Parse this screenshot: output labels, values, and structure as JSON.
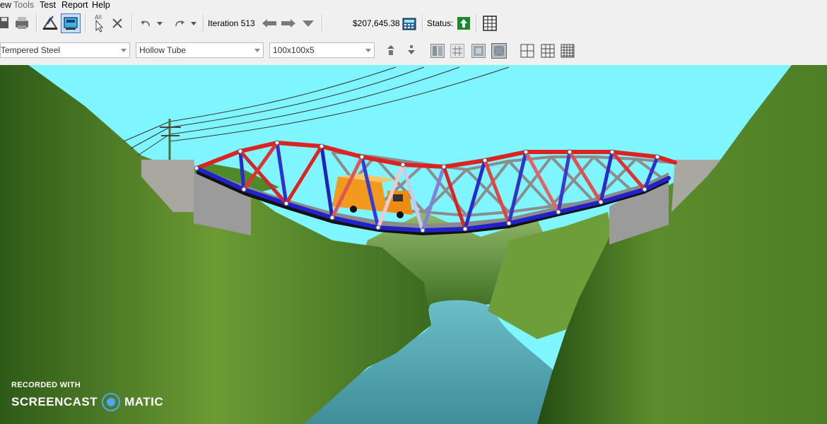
{
  "menu": {
    "view": "ew",
    "tools": "Tools",
    "test": "Test",
    "report": "Report",
    "help": "Help"
  },
  "toolbar": {
    "select_all_label": "All",
    "iteration": "Iteration 513",
    "cost": "$207,645.38",
    "status_label": "Status:",
    "status_color": "#1a8a2a"
  },
  "material": {
    "selected": "Tempered Steel"
  },
  "section": {
    "selected": "Hollow Tube"
  },
  "size": {
    "selected": "100x100x5"
  },
  "watermark": {
    "line1": "RECORDED WITH",
    "brand_left": "SCREENCAST",
    "brand_right": "MATIC"
  },
  "scene_colors": {
    "sky": "#7ff6ff",
    "tension_member": "#dd2222",
    "compression_member": "#2222cc",
    "truck": "#f29a1e",
    "river": "#5aa6b3"
  }
}
